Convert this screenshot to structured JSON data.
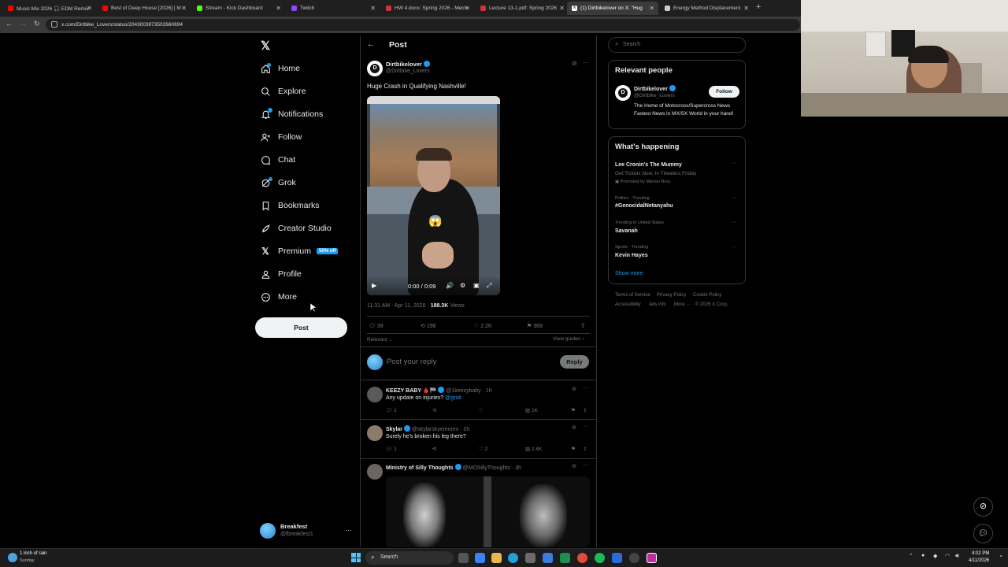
{
  "browser": {
    "tabs": [
      {
        "title": "Music Mix 2026 🎧 EDM Remix",
        "color": "#ff0000"
      },
      {
        "title": "Best of Deep House [2026] | M",
        "color": "#ff0000"
      },
      {
        "title": "Stream - Kick Dashboard",
        "color": "#53fc18"
      },
      {
        "title": "Twitch",
        "color": "#9146ff"
      },
      {
        "title": "HW 4.docx: Spring 2026 - Mech",
        "color": "#d13438"
      },
      {
        "title": "Lecture 13-1.pdf: Spring 2026",
        "color": "#d13438"
      },
      {
        "title": "(1) Dirtbikelover on X: \"Hug",
        "color": "#ffffff"
      },
      {
        "title": "Energy Method Displacement",
        "color": "#cccccc"
      }
    ],
    "url": "x.com/Dirtbike_Lovers/status/2043003973502660694"
  },
  "nav": {
    "items": [
      {
        "label": "Home",
        "icon": "home-icon"
      },
      {
        "label": "Explore",
        "icon": "search-icon"
      },
      {
        "label": "Notifications",
        "icon": "bell-icon"
      },
      {
        "label": "Follow",
        "icon": "person-add-icon"
      },
      {
        "label": "Chat",
        "icon": "chat-icon"
      },
      {
        "label": "Grok",
        "icon": "grok-icon"
      },
      {
        "label": "Bookmarks",
        "icon": "bookmark-icon"
      },
      {
        "label": "Creator Studio",
        "icon": "rocket-icon"
      },
      {
        "label": "Premium",
        "icon": "x-logo-icon"
      },
      {
        "label": "Profile",
        "icon": "person-icon"
      },
      {
        "label": "More",
        "icon": "more-circle-icon"
      }
    ],
    "premium_badge": "50% off",
    "post_button": "Post",
    "account": {
      "name": "Breakfest",
      "handle": "@fbreakfest1"
    }
  },
  "post": {
    "header": "Post",
    "author_name": "Dirtbikelover",
    "author_handle": "@Dirtbike_Lovers",
    "text": "Huge Crash in Qualifying Nashville!",
    "video_time": "0:00 / 0:09",
    "timestamp": "11:31 AM · Apr 11, 2026 · ",
    "views_count": "188.3K",
    "views_label": " Views",
    "stats": {
      "replies": "39",
      "reposts": "196",
      "likes": "2.2K",
      "bookmarks": "369"
    },
    "sort_label": "Relevant",
    "view_quotes": "View quotes",
    "reply_placeholder": "Post your reply",
    "reply_button": "Reply"
  },
  "replies": [
    {
      "name": "KEEZY BABY 🩸🏁",
      "handle": "@1keezybaby · 1h",
      "text": "Any update on injuries? ",
      "mention": "@grok",
      "replies": "1",
      "reposts": "",
      "likes": "",
      "views": "1K"
    },
    {
      "name": "Skylar",
      "handle": "@skylarskyemorex · 2h",
      "text": "Surely he's broken his leg there?",
      "mention": "",
      "replies": "1",
      "reposts": "",
      "likes": "2",
      "views": "2.4K"
    },
    {
      "name": "Ministry of Silly Thoughts",
      "handle": "@MOSillyThoughts · 3h",
      "text": "",
      "mention": "",
      "replies": "",
      "reposts": "",
      "likes": "",
      "views": ""
    }
  ],
  "right": {
    "search_placeholder": "Search",
    "relevant_title": "Relevant people",
    "relevant_name": "Dirtbikelover",
    "relevant_handle": "@Dirtbike_Lovers",
    "relevant_bio": "The Home of Motocross/Supercross News Fastest News in MX/SX World in your hand!",
    "follow_button": "Follow",
    "happening_title": "What's happening",
    "trends": [
      {
        "meta": "",
        "title": "Lee Cronin's The Mummy",
        "sub": "Get Tickets Now, In Theaters Friday",
        "promo": "Promoted by Warner Bros."
      },
      {
        "meta": "Politics · Trending",
        "title": "#GenocidalNetanyahu",
        "sub": "",
        "promo": ""
      },
      {
        "meta": "Trending in United States",
        "title": "Savanah",
        "sub": "",
        "promo": ""
      },
      {
        "meta": "Sports · Trending",
        "title": "Kevin Hayes",
        "sub": "",
        "promo": ""
      }
    ],
    "show_more": "Show more",
    "footer": [
      "Terms of Service",
      "Privacy Policy",
      "Cookie Policy",
      "Accessibility",
      "Ads info",
      "More ···",
      "© 2026 X Corp."
    ]
  },
  "taskbar": {
    "weather_title": "1 inch of rain",
    "weather_sub": "Sunday",
    "search_label": "Search",
    "time": "4:02 PM",
    "date": "4/11/2026"
  },
  "colors": {
    "accent": "#1d9bf0",
    "bg": "#000000",
    "border": "#2f3336"
  }
}
